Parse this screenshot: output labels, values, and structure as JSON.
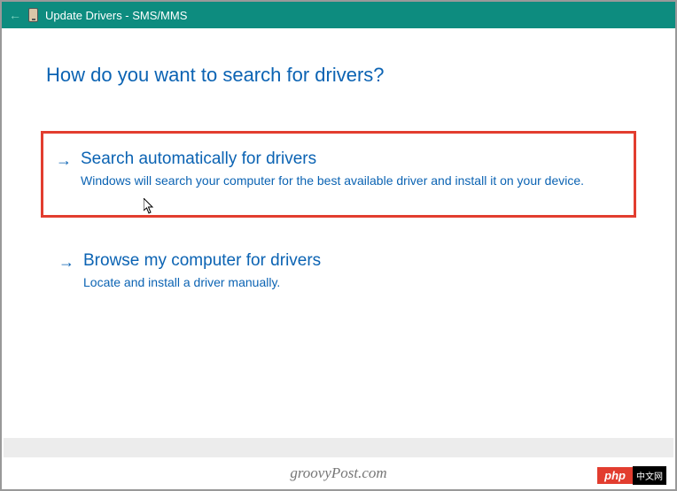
{
  "titlebar": {
    "title": "Update Drivers - SMS/MMS"
  },
  "heading": "How do you want to search for drivers?",
  "options": [
    {
      "title": "Search automatically for drivers",
      "desc": "Windows will search your computer for the best available driver and install it on your device."
    },
    {
      "title": "Browse my computer for drivers",
      "desc": "Locate and install a driver manually."
    }
  ],
  "watermark": "groovyPost.com",
  "badge": {
    "left": "php",
    "right": "中文网"
  }
}
